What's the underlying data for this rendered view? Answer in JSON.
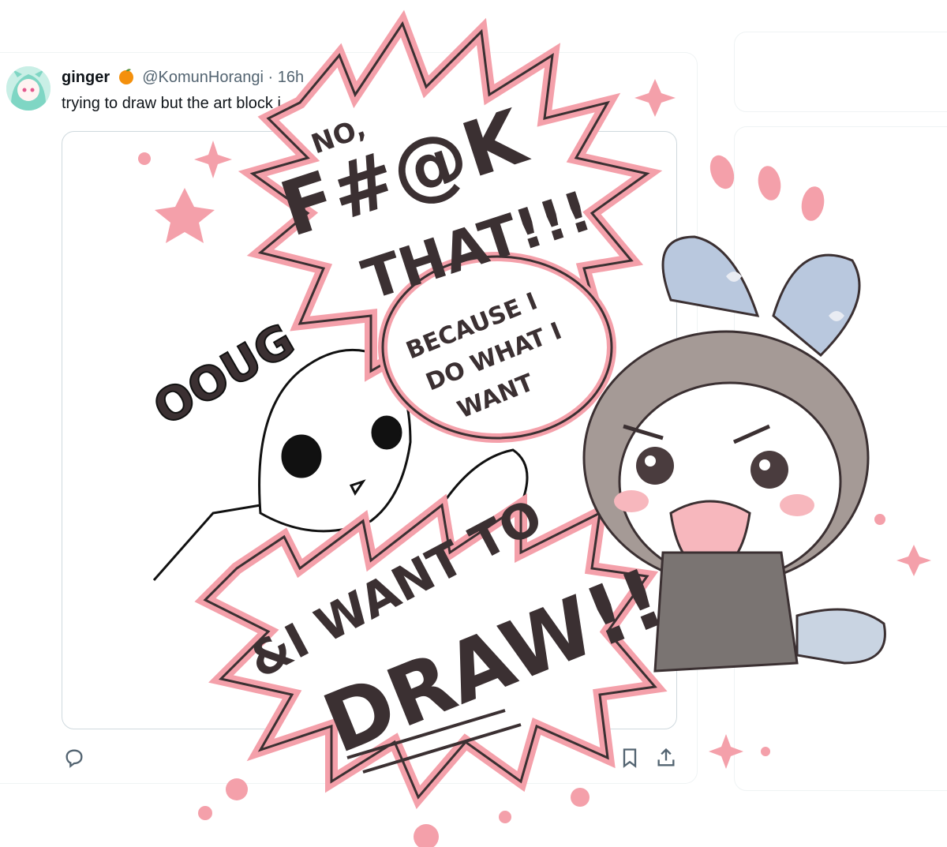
{
  "tweet": {
    "display_name": "ginger",
    "emoji_icon": "orange-emoji",
    "handle": "@KomunHorangi",
    "separator": "·",
    "time": "16h",
    "text": "trying to draw but the art block i"
  },
  "actions": {
    "reply_icon": "reply-icon",
    "bookmark_icon": "bookmark-icon",
    "share_icon": "share-icon"
  },
  "artwork": {
    "sketch_text": "OOUG",
    "bubble_small": "NO,",
    "bubble_main_1": "F#@K",
    "bubble_main_2": "THAT!!!",
    "bubble_inner_1": "BECAUSE I",
    "bubble_inner_2": "DO WHAT I",
    "bubble_inner_3": "WANT",
    "bubble_bottom_1": "&I WANT TO",
    "bubble_bottom_2": "DRAW!!",
    "accent_color": "#f4a0aa",
    "bow_color": "#b9c8de"
  }
}
